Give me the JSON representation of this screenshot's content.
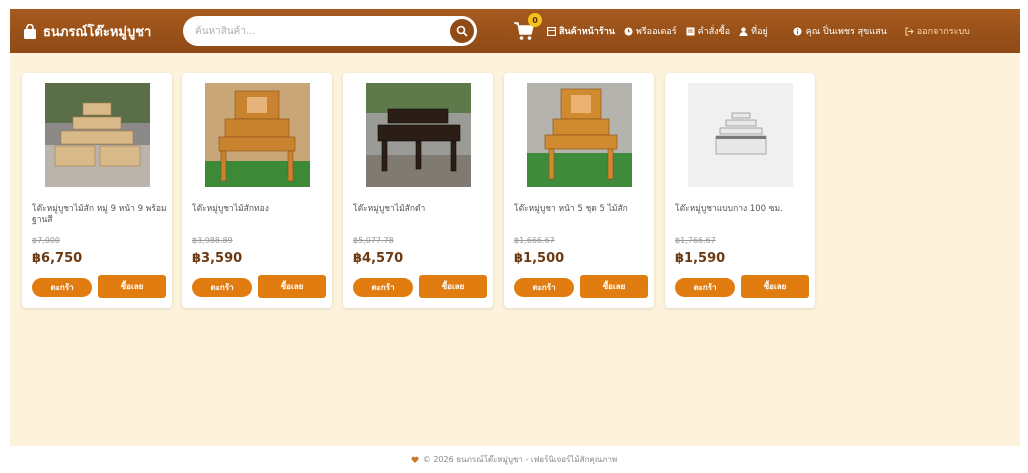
{
  "navbar": {
    "brand": "ธนภรณ์โต๊ะหมู่บูชา",
    "search_placeholder": "ค้นหาสินค้า...",
    "cart_count": "0",
    "links": [
      {
        "label": "สินค้าหน้าร้าน",
        "icon": "storefront-icon",
        "active": true
      },
      {
        "label": "พรีออเดอร์",
        "icon": "preorder-icon"
      },
      {
        "label": "คำสั่งซื้อ",
        "icon": "orders-icon"
      },
      {
        "label": "ที่อยู่",
        "icon": "address-icon"
      }
    ],
    "user_label": "คุณ ปิ่นเพชร สุขแสน",
    "logout_label": "ออกจากระบบ"
  },
  "products": [
    {
      "name": "โต๊ะหมู่บูชาไม้สัก หมู่ 9 หน้า 9 พร้อมฐานสี",
      "old_price": "฿7,000",
      "price": "฿6,750",
      "image": "tiered-teak-altar-photo"
    },
    {
      "name": "โต๊ะหมู่บูชาไม้สักทอง",
      "old_price": "฿3,988.89",
      "price": "฿3,590",
      "image": "golden-teak-altar-photo"
    },
    {
      "name": "โต๊ะหมู่บูชาไม้สักดำ",
      "old_price": "฿5,077.78",
      "price": "฿4,570",
      "image": "black-teak-altar-photo"
    },
    {
      "name": "โต๊ะหมู่บูชา หน้า 5 ชุด 5 ไม้สัก",
      "old_price": "฿1,666.67",
      "price": "฿1,500",
      "image": "five-inch-altar-photo"
    },
    {
      "name": "โต๊ะหมู่บูชาแบบกาง 100 ซม.",
      "old_price": "฿1,766.67",
      "price": "฿1,590",
      "image": "white-altar-render"
    }
  ],
  "buttons": {
    "add_to_cart": "ตะกร้า",
    "buy_now": "ซื้อเลย"
  },
  "footer": {
    "text": "© 2026 ธนภรณ์โต๊ะหมู่บูชา - เฟอร์นิเจอร์ไม้สักคุณภาพ"
  },
  "colors": {
    "navbar": "#9b5219",
    "background": "#fdf3dc",
    "accent": "#e07c10",
    "badge": "#f5c21b"
  }
}
